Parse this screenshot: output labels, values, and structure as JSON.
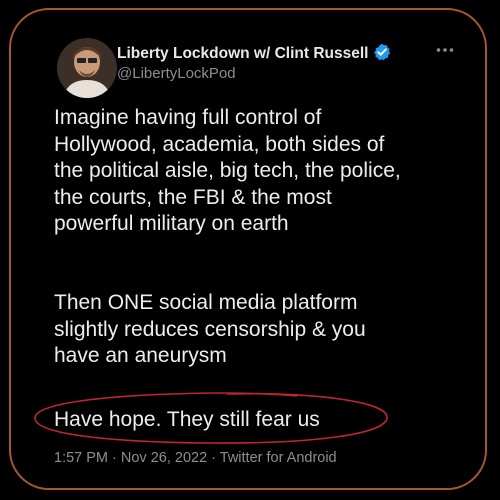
{
  "tweet": {
    "author_name": "Liberty Lockdown w/ Clint Russell",
    "handle": "@LibertyLockPod",
    "more_icon": "ellipsis-icon",
    "verified_icon": "verified-badge-icon",
    "paragraph1": [
      "Imagine having full control of",
      "Hollywood, academia, both sides of",
      "the political aisle, big tech, the police,",
      "the courts, the FBI & the most",
      "powerful military on earth"
    ],
    "paragraph2": [
      "Then ONE social media platform",
      "slightly reduces censorship & you",
      "have an aneurysm"
    ],
    "paragraph3": "Have hope. They still fear us",
    "timestamp": "1:57 PM · Nov 26, 2022 · Twitter for Android"
  },
  "colors": {
    "frame_border": "#a8582a",
    "highlight_circle": "#c0262f",
    "verified_badge": "#1d9bf0"
  }
}
